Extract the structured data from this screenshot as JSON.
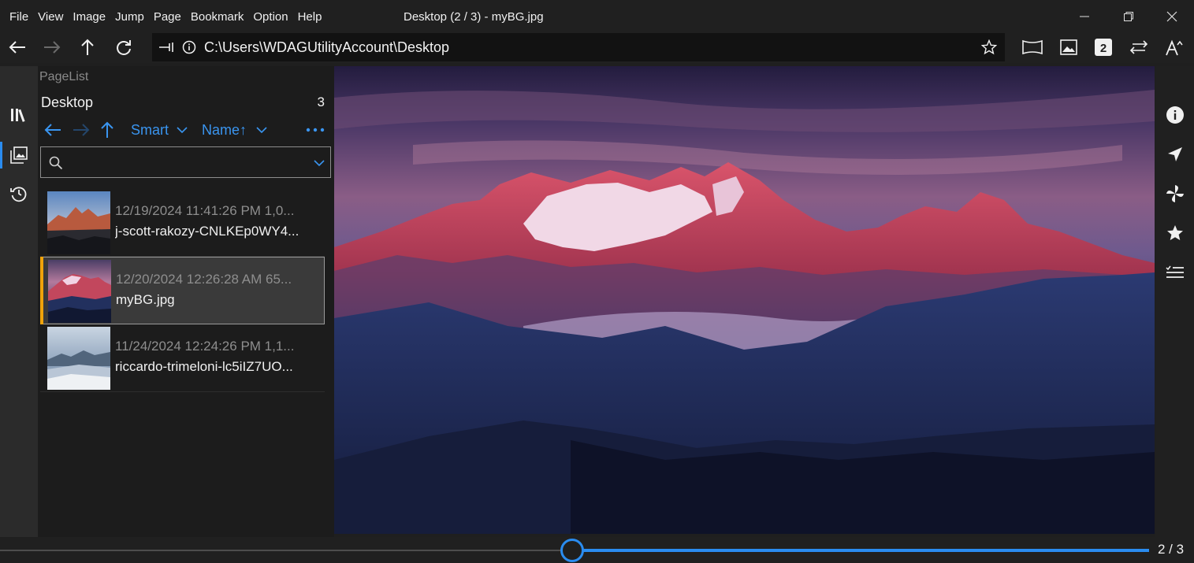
{
  "menu": [
    "File",
    "View",
    "Image",
    "Jump",
    "Page",
    "Bookmark",
    "Option",
    "Help"
  ],
  "window_title": "Desktop (2 / 3) - myBG.jpg",
  "address": {
    "path": "C:\\Users\\WDAGUtilityAccount\\Desktop"
  },
  "panel": {
    "label": "PageList",
    "title": "Desktop",
    "count": "3",
    "sort_mode": "Smart",
    "sort_key": "Name↑",
    "items": [
      {
        "meta": "12/19/2024 11:41:26 PM   1,0...",
        "name": "j-scott-rakozy-CNLKEp0WY4...",
        "selected": false
      },
      {
        "meta": "12/20/2024 12:26:28 AM   65...",
        "name": "myBG.jpg",
        "selected": true
      },
      {
        "meta": "11/24/2024 12:24:26 PM   1,1...",
        "name": "riccardo-trimeloni-lc5iIZ7UO...",
        "selected": false
      }
    ]
  },
  "slider": {
    "page_indicator": "2 / 3",
    "position_fraction": 0.5
  },
  "colors": {
    "accent": "#2a8cf0",
    "selection_bar": "#f0a30a",
    "background": "#1f1f1f"
  }
}
